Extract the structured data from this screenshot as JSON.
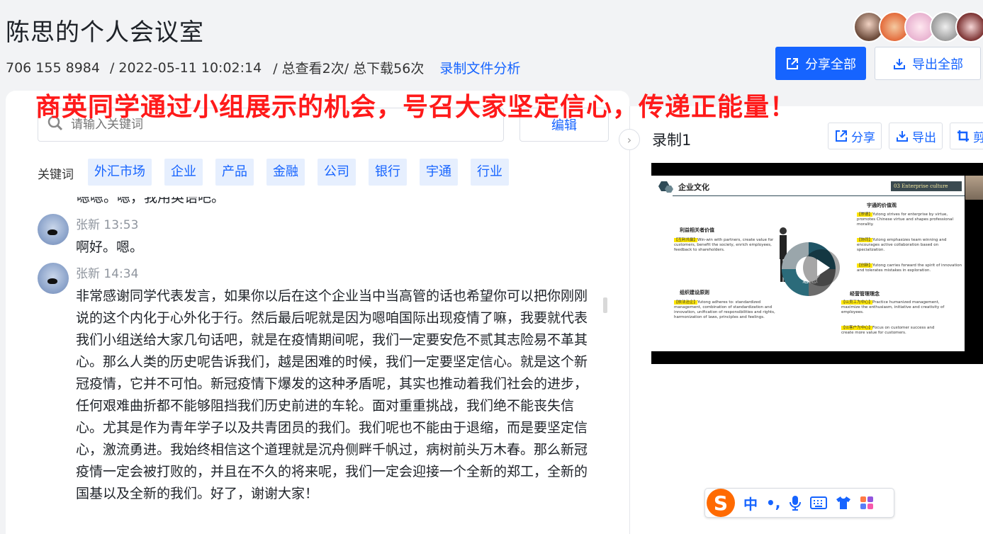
{
  "header": {
    "title": "陈思的个人会议室",
    "meeting_id": "706 155 8984",
    "datetime": "/ 2022-05-11 10:02:14",
    "views": "/ 总查看2次/ 总下载56次",
    "analysis_link": "录制文件分析",
    "share_all_label": "分享全部",
    "export_all_label": "导出全部"
  },
  "banner": "商英同学通过小组展示的机会，号召大家坚定信心，传递正能量！",
  "search": {
    "placeholder": "请输入关键词",
    "edit_label": "编辑"
  },
  "keywords": {
    "label": "关键词",
    "items": [
      "外汇市场",
      "企业",
      "产品",
      "金融",
      "公司",
      "银行",
      "宇通",
      "行业"
    ]
  },
  "transcript": {
    "partial_line": "嗯嗯。嗯，我用英语吧。",
    "messages": [
      {
        "speaker": "张新",
        "time": "13:53",
        "text": "啊好。嗯。"
      },
      {
        "speaker": "张新",
        "time": "14:34",
        "text": "非常感谢同学代表发言，如果你以后在这个企业当中当高管的话也希望你可以把你刚刚说的这个内化于心外化于行。然后最后呢就是因为嗯咱国际出现疫情了嘛，我要就代表我们小组送给大家几句话吧，就是在疫情期间呢，我们一定要安危不贰其志险易不革其心。那么人类的历史呢告诉我们，越是困难的时候，我们一定要坚定信心。就是这个新冠疫情，它并不可怕。新冠疫情下爆发的这种矛盾呢，其实也推动着我们社会的进步，任何艰难曲折都不能够阻挡我们历史前进的车轮。面对重重挑战，我们绝不能丧失信心。尤其是作为青年学子以及共青团员的我们。我们呢也不能由于退缩，而是要坚定信心，激流勇进。我始终相信这个道理就是沉舟侧畔千帆过，病树前头万木春。那么新冠疫情一定会被打败的，并且在不久的将来呢，我们一定会迎接一个全新的郑工，全新的国基以及全新的我们。好了，谢谢大家！"
      }
    ]
  },
  "recording": {
    "title": "录制1",
    "tools": [
      "分享",
      "导出",
      "剪"
    ]
  },
  "slide": {
    "title": "企业文化",
    "tag": "03  Enterprise culture",
    "core": "核心思想",
    "sections": [
      {
        "head": "利益相关者价值",
        "hl": "【互利共赢】",
        "text": "Win-win with partners, create value for customers, benefit the society, enrich employees, feedback to shareholders."
      },
      {
        "head": "宇通的价值观",
        "hl": "【崇德】",
        "text": "Yutong strives for enterprise by virtue, promotes Chinese virtue and shapes professional morality."
      },
      {
        "head": "",
        "hl": "【协同】",
        "text": "Yutong emphasizes team winning and encourages active collaboration based on specialization."
      },
      {
        "head": "",
        "hl": "【创新】",
        "text": "Yutong carries forward the spirit of innovation and tolerates mistakes in exploration."
      },
      {
        "head": "组织建设原则",
        "hl": "【依法治企】",
        "text": "Yutong adheres to: standardized management, combination of standardization and innovation, unification of responsibilities and rights, harmonization of laws, principles and feelings."
      },
      {
        "head": "经营管理理念",
        "hl": "【以员工为中心】",
        "text": "Practice humanized management, maximize the enthusiasm, initiative and creativity of employees."
      },
      {
        "head": "",
        "hl": "【以客户为中心】",
        "text": "Focus on customer success and create more value for customers."
      }
    ]
  },
  "ime": {
    "logo": "S",
    "mode": "中",
    "punct": "•,"
  },
  "colors": {
    "accent": "#1664ff",
    "banner": "#ff1a1a",
    "tag_bg": "#e6effe",
    "ime_orange": "#ff6a00"
  }
}
